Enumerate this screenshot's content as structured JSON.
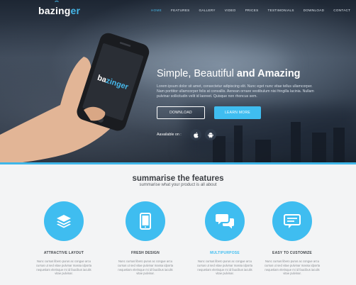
{
  "brand": {
    "logo_main": "bazing",
    "logo_accent": "er",
    "phone_logo_main": "ba",
    "phone_logo_accent": "zinger"
  },
  "nav": {
    "items": [
      {
        "label": "HOME",
        "active": true
      },
      {
        "label": "FEATURES",
        "active": false
      },
      {
        "label": "GALLERY",
        "active": false
      },
      {
        "label": "VIDEO",
        "active": false
      },
      {
        "label": "PRICES",
        "active": false
      },
      {
        "label": "TESTIMONIALS",
        "active": false
      },
      {
        "label": "DOWNLOAD",
        "active": false
      },
      {
        "label": "CONTACT",
        "active": false
      }
    ]
  },
  "hero": {
    "title_light": "Simple, Beautiful ",
    "title_bold": "and Amazing",
    "text": "Lorem ipsum dolor sit amet, consectetur adipiscing elit. Nunc eget nunc vitae tellus ullamcorper. Nam porttitor ullamcorper felis at convallis. Aenean ornare vestibulum nisi fringilla lacinia. Nullam pulvinar sollicitudin velit id laoreet. Quisque non rhoncus sem.",
    "download_label": "DOWNLOAD",
    "learn_label": "LEARN MORE",
    "available_label": "Aavailable on :",
    "stores": [
      "apple-icon",
      "android-icon"
    ]
  },
  "features": {
    "title": "summarise the features",
    "subtitle": "summarise what your product is all about",
    "items": [
      {
        "icon": "layers-icon",
        "title": "ATTRACTIVE LAYOUT",
        "highlight": false,
        "desc": "Nunc cursus libero purus ac congue arcu cursus ut sed vitae pulvinar massa idporta nequetiam elerisque mi id faucibus iaculis vitae pulvinar."
      },
      {
        "icon": "tablet-icon",
        "title": "FRESH DESIGN",
        "highlight": false,
        "desc": "Nunc cursus libero purus ac congue arcu cursus ut sed vitae pulvinar massa idporta nequetiam elerisque mi id faucibus iaculis vitae pulvinar."
      },
      {
        "icon": "chat-icon",
        "title": "MULTIPURPOSE",
        "highlight": true,
        "desc": "Nunc cursus libero purus ac congue arcu cursus ut sed vitae pulvinar massa idporta nequetiam elerisque mi id faucibus iaculis vitae pulvinar."
      },
      {
        "icon": "monitor-chat-icon",
        "title": "EASY TO CUSTOMIZE",
        "highlight": false,
        "desc": "Nunc cursus libero purus ac congue arcu cursus ut sed vitae pulvinar massa idporta nequetiam elerisque mi id faucibus iaculis vitae pulvinar."
      }
    ]
  },
  "colors": {
    "accent": "#3fbdf0",
    "heading": "#3c3f44",
    "hero_dark": "#1d2633"
  }
}
